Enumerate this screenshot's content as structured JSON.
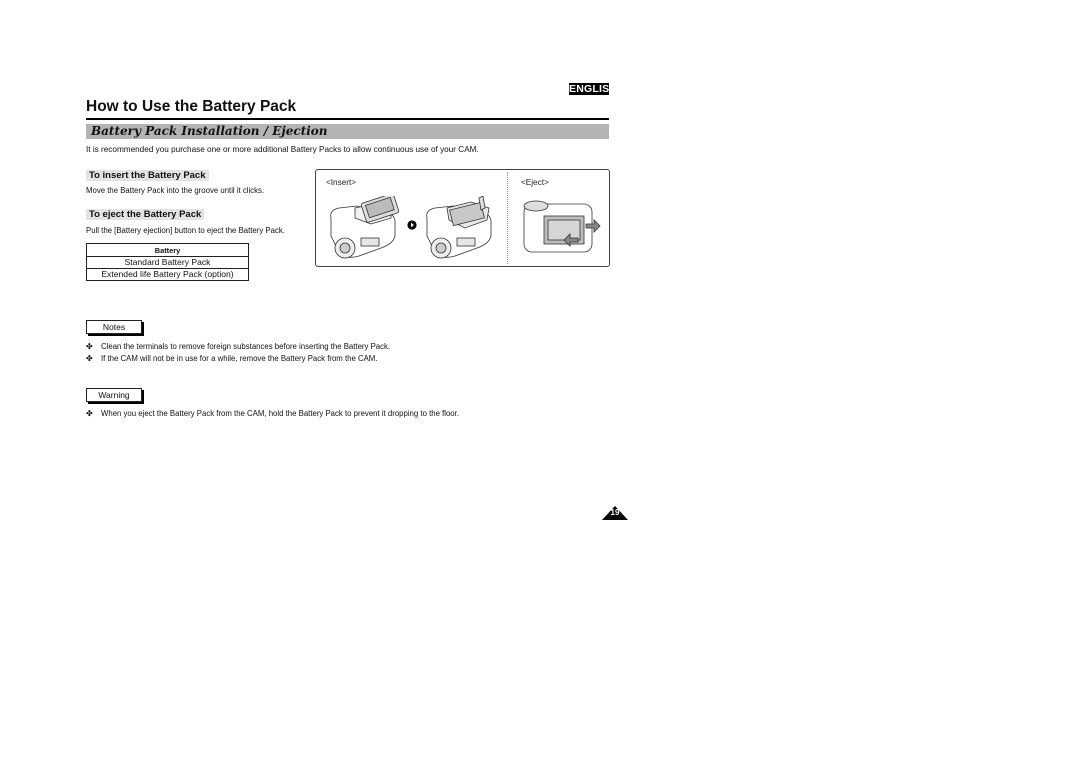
{
  "header": {
    "language_badge": "ENGLISH",
    "page_title": "How to Use the Battery Pack",
    "section_title": "Battery Pack Installation / Ejection",
    "intro_text": "It is recommended you purchase one or more additional Battery Packs to allow continuous use of your CAM."
  },
  "instructions": {
    "insert": {
      "heading": "To insert the Battery Pack",
      "text": "Move the Battery Pack into the groove until it clicks."
    },
    "eject": {
      "heading": "To eject the Battery Pack",
      "text": "Pull the [Battery ejection] button to eject the Battery Pack."
    }
  },
  "battery_table": {
    "header": "Battery",
    "rows": [
      "Standard Battery Pack",
      "Extended life Battery Pack (option)"
    ]
  },
  "figure": {
    "insert_label": "<Insert>",
    "eject_label": "<Eject>",
    "images": [
      "camcorder-battery-insert-step1",
      "camcorder-battery-insert-step2",
      "camcorder-battery-eject"
    ],
    "step_arrow_icon": "circle-play-arrow-icon"
  },
  "notes": {
    "label": "Notes",
    "bullet_icon": "four-petal-bullet",
    "items": [
      "Clean the terminals to remove foreign substances before inserting the Battery Pack.",
      "If the CAM will not be in use for a while, remove the Battery Pack from the CAM."
    ]
  },
  "warning": {
    "label": "Warning",
    "items": [
      "When you eject the Battery Pack from the CAM, hold the Battery Pack to prevent it dropping to the floor."
    ]
  },
  "footer": {
    "page_number": "19"
  }
}
